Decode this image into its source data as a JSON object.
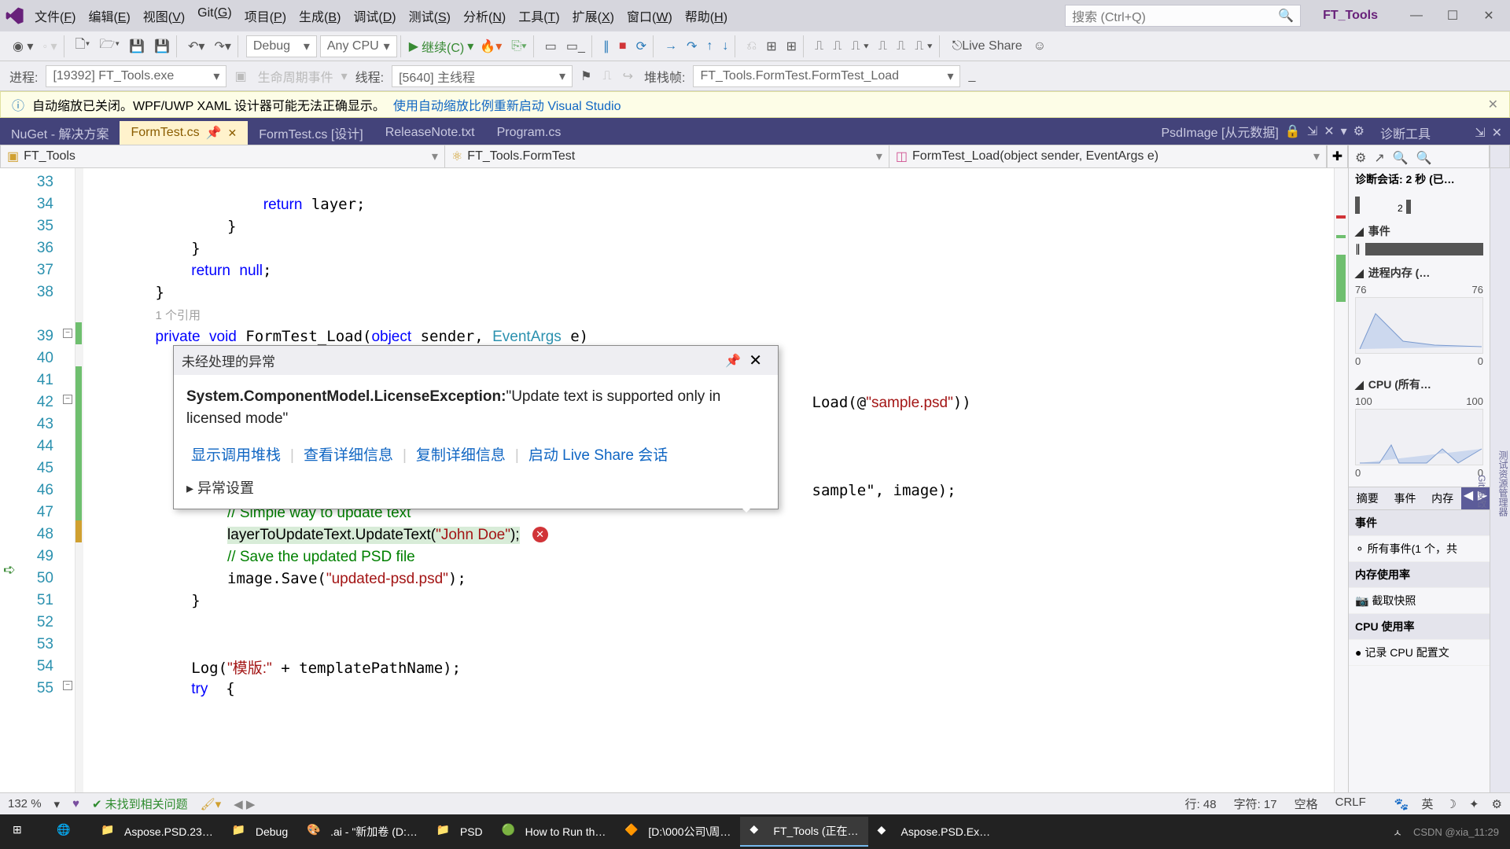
{
  "title_bar": {
    "menus": [
      {
        "label": "文件",
        "key": "F"
      },
      {
        "label": "编辑",
        "key": "E"
      },
      {
        "label": "视图",
        "key": "V"
      },
      {
        "label": "Git",
        "key": "G"
      },
      {
        "label": "项目",
        "key": "P"
      },
      {
        "label": "生成",
        "key": "B"
      },
      {
        "label": "调试",
        "key": "D"
      },
      {
        "label": "测试",
        "key": "S"
      },
      {
        "label": "分析",
        "key": "N"
      },
      {
        "label": "工具",
        "key": "T"
      },
      {
        "label": "扩展",
        "key": "X"
      },
      {
        "label": "窗口",
        "key": "W"
      },
      {
        "label": "帮助",
        "key": "H"
      }
    ],
    "search_placeholder": "搜索 (Ctrl+Q)",
    "solution": "FT_Tools"
  },
  "toolbar1": {
    "config": "Debug",
    "platform": "Any CPU",
    "continue": "继续(C)",
    "live_share": "Live Share"
  },
  "toolbar2": {
    "proc_label": "进程:",
    "proc_value": "[19392] FT_Tools.exe",
    "lifecycle": "生命周期事件",
    "thread_label": "线程:",
    "thread_value": "[5640] 主线程",
    "stack_label": "堆栈帧:",
    "stack_value": "FT_Tools.FormTest.FormTest_Load"
  },
  "info_bar": {
    "msg": "自动缩放已关闭。WPF/UWP XAML 设计器可能无法正确显示。",
    "link": "使用自动缩放比例重新启动 Visual Studio"
  },
  "tabs": {
    "items": [
      {
        "label": "NuGet - 解决方案",
        "active": false
      },
      {
        "label": "FormTest.cs",
        "active": true,
        "pin": true
      },
      {
        "label": "FormTest.cs [设计]",
        "active": false
      },
      {
        "label": "ReleaseNote.txt",
        "active": false
      },
      {
        "label": "Program.cs",
        "active": false
      }
    ],
    "right_label": "PsdImage [从元数据]",
    "diag_title": "诊断工具"
  },
  "nav": {
    "project": "FT_Tools",
    "class": "FT_Tools.FormTest",
    "method": "FormTest_Load(object sender, EventArgs e)"
  },
  "code": {
    "lines": [
      {
        "n": 33,
        "html": ""
      },
      {
        "n": 34,
        "html": "                    <span class='kw'>return</span> layer;"
      },
      {
        "n": 35,
        "html": "                }"
      },
      {
        "n": 36,
        "html": "            }"
      },
      {
        "n": 37,
        "html": "            <span class='kw'>return</span> <span class='kw'>null</span>;"
      },
      {
        "n": 38,
        "html": "        }"
      },
      {
        "n": 0,
        "html": "        <span class='ref'>1 个引用</span>"
      },
      {
        "n": 39,
        "html": "        <span class='kw'>private</span> <span class='kw'>void</span> FormTest_Load(<span class='kw'>object</span> sender, <span class='type'>EventArgs</span> e)"
      },
      {
        "n": 40,
        "html": ""
      },
      {
        "n": 41,
        "html": ""
      },
      {
        "n": 42,
        "html": "                                                                                 Load(@<span class='str'>\"sample.psd\"</span>))"
      },
      {
        "n": 43,
        "html": ""
      },
      {
        "n": 44,
        "html": ""
      },
      {
        "n": 45,
        "html": ""
      },
      {
        "n": 46,
        "html": "                                                                                 sample\", image);"
      },
      {
        "n": 47,
        "html": "                <span class='cmt'>// Simple way to update text</span>"
      },
      {
        "n": 48,
        "html": "                <span class='hl-line'>layerToUpdateText.UpdateText(<span class='str'>\"John Doe\"</span>);</span>",
        "err": true
      },
      {
        "n": 49,
        "html": "                <span class='cmt'>// Save the updated PSD file</span>"
      },
      {
        "n": 50,
        "html": "                image.Save(<span class='str'>\"updated-psd.psd\"</span>);"
      },
      {
        "n": 51,
        "html": "            }"
      },
      {
        "n": 52,
        "html": ""
      },
      {
        "n": 53,
        "html": ""
      },
      {
        "n": 54,
        "html": "            Log(<span class='str'>\"模版:\"</span> + templatePathName);"
      },
      {
        "n": 55,
        "html": "            <span class='kw'>try</span>  {"
      }
    ]
  },
  "exception": {
    "title": "未经处理的异常",
    "type": "System.ComponentModel.LicenseException:",
    "msg": "\"Update text is supported only in licensed mode\"",
    "links": [
      "显示调用堆栈",
      "查看详细信息",
      "复制详细信息",
      "启动 Live Share 会话"
    ],
    "settings": "异常设置"
  },
  "diag": {
    "session": "诊断会话: 2 秒 (已…",
    "events": "事件",
    "mem_title": "进程内存 (…",
    "mem_left": "76",
    "mem_right": "76",
    "mem_zero": "0",
    "cpu_title": "CPU (所有…",
    "cpu_left": "100",
    "cpu_right": "100",
    "cpu_zero": "0",
    "tabs": [
      "摘要",
      "事件",
      "内存"
    ],
    "sec_events": "事件",
    "all_events": "所有事件(1 个，共",
    "mem_usage": "内存使用率",
    "snapshot": "截取快照",
    "cpu_usage": "CPU 使用率",
    "record": "记录 CPU 配置文"
  },
  "status": {
    "zoom": "132 %",
    "ok": "未找到相关问题",
    "line": "行: 48",
    "col": "字符: 17",
    "spaces": "空格",
    "crlf": "CRLF",
    "ime": "英"
  },
  "taskbar": {
    "items": [
      {
        "label": "",
        "icon": "win"
      },
      {
        "label": "",
        "icon": "edge"
      },
      {
        "label": "Aspose.PSD.23…",
        "icon": "folder"
      },
      {
        "label": "Debug",
        "icon": "folder"
      },
      {
        "label": ".ai - \"新加卷 (D:…",
        "icon": "ai"
      },
      {
        "label": "PSD",
        "icon": "folder"
      },
      {
        "label": "How to Run th…",
        "icon": "chrome"
      },
      {
        "label": "[D:\\000公司\\周…",
        "icon": "vlc"
      },
      {
        "label": "FT_Tools (正在…",
        "icon": "vs",
        "active": true
      },
      {
        "label": "Aspose.PSD.Ex…",
        "icon": "vs"
      }
    ],
    "watermark": "CSDN @xia_11:29",
    "time": ""
  }
}
